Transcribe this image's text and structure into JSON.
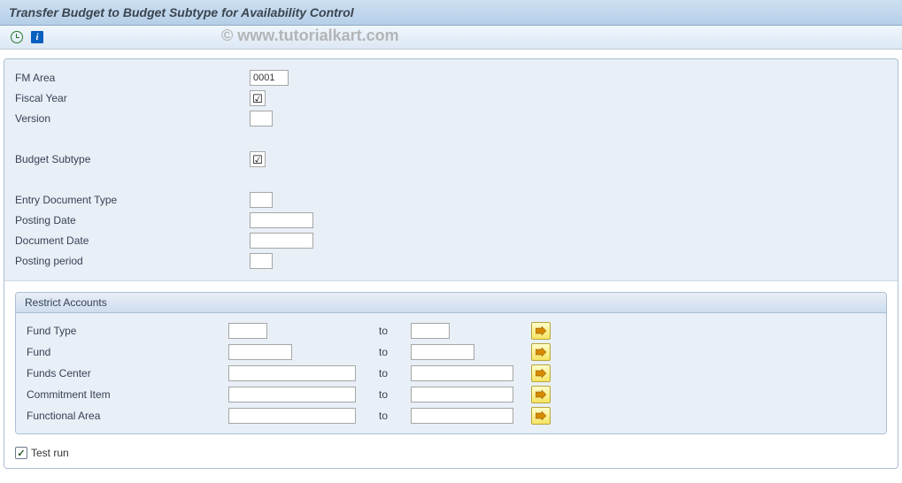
{
  "title": "Transfer Budget to Budget Subtype for Availability Control",
  "watermark": "© www.tutorialkart.com",
  "info_glyph": "i",
  "form": {
    "fm_area": {
      "label": "FM Area",
      "value": "0001"
    },
    "fiscal_year": {
      "label": "Fiscal Year"
    },
    "version": {
      "label": "Version",
      "value": ""
    },
    "budget_subtype": {
      "label": "Budget Subtype"
    },
    "entry_doc_type": {
      "label": "Entry Document Type",
      "value": ""
    },
    "posting_date": {
      "label": "Posting Date",
      "value": ""
    },
    "document_date": {
      "label": "Document Date",
      "value": ""
    },
    "posting_period": {
      "label": "Posting period",
      "value": ""
    }
  },
  "group": {
    "title": "Restrict Accounts",
    "to_text": "to",
    "rows": {
      "fund_type": {
        "label": "Fund Type"
      },
      "fund": {
        "label": "Fund"
      },
      "funds_center": {
        "label": "Funds Center"
      },
      "commitment_item": {
        "label": "Commitment Item"
      },
      "functional_area": {
        "label": "Functional Area"
      }
    }
  },
  "test_run": {
    "label": "Test run",
    "checked": true
  }
}
